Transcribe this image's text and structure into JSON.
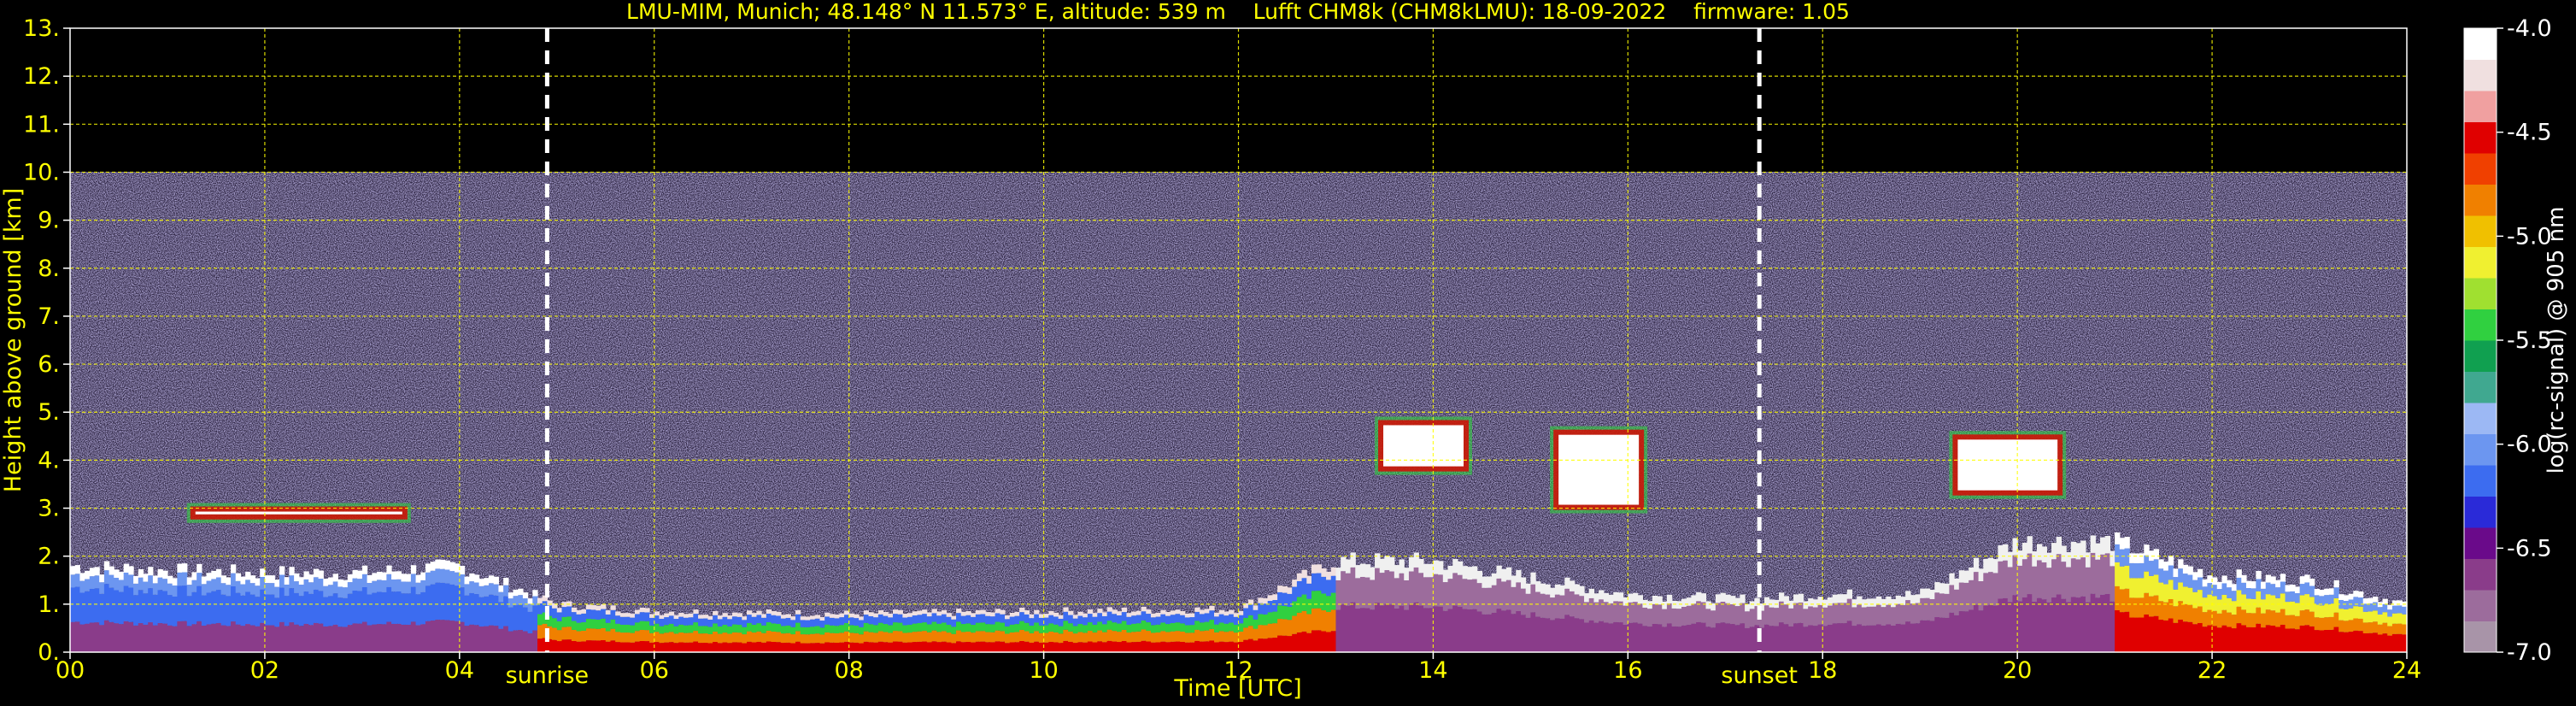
{
  "chart_data": {
    "type": "heatmap",
    "title": "LMU-MIM, Munich; 48.148° N 11.573° E, altitude: 539 m    Lufft CHM8k (CHM8kLMU): 18-09-2022    firmware: 1.05",
    "xlabel": "Time [UTC]",
    "ylabel": "Height above ground [km]",
    "xlim": [
      0,
      24
    ],
    "ylim": [
      0,
      13
    ],
    "x_ticks": [
      "00",
      "02",
      "04",
      "06",
      "08",
      "10",
      "12",
      "14",
      "16",
      "18",
      "20",
      "22",
      "24"
    ],
    "y_ticks": [
      "0.",
      "1.",
      "2.",
      "3.",
      "4.",
      "5.",
      "6.",
      "7.",
      "8.",
      "9.",
      "10.",
      "11.",
      "12.",
      "13."
    ],
    "grid": true,
    "measurement_top_km": 10,
    "annotations": [
      {
        "label": "sunrise",
        "time_h": 4.9
      },
      {
        "label": "sunset",
        "time_h": 17.35
      }
    ],
    "colorbar": {
      "label": "log(rc-signal) @ 905 nm",
      "range": [
        -7.0,
        -4.0
      ],
      "ticks": [
        "-4.0",
        "-4.5",
        "-5.0",
        "-5.5",
        "-6.0",
        "-6.5",
        "-7.0"
      ],
      "colors": [
        "#a894a8",
        "#9c6c9c",
        "#8a3c8a",
        "#6a0a8a",
        "#2a2ad8",
        "#3c6cf0",
        "#6c96f0",
        "#9cb8f4",
        "#40a890",
        "#10a050",
        "#30d040",
        "#a0e030",
        "#f0f030",
        "#f0c000",
        "#f08000",
        "#f04000",
        "#e00000",
        "#f0a0a0",
        "#f0e0e0",
        "#ffffff"
      ]
    },
    "features": {
      "boundary_layer": [
        [
          0,
          1.8
        ],
        [
          1,
          1.7
        ],
        [
          2,
          1.65
        ],
        [
          3,
          1.65
        ],
        [
          4,
          1.8
        ],
        [
          5,
          1.0
        ],
        [
          6,
          0.85
        ],
        [
          8,
          0.8
        ],
        [
          10,
          0.85
        ],
        [
          12,
          0.9
        ],
        [
          13,
          1.9
        ],
        [
          14,
          1.9
        ],
        [
          16,
          1.2
        ],
        [
          17.3,
          1.1
        ],
        [
          18,
          1.2
        ],
        [
          19,
          1.2
        ],
        [
          20,
          2.3
        ],
        [
          21,
          2.3
        ],
        [
          22,
          1.6
        ],
        [
          23,
          1.5
        ],
        [
          24,
          1.0
        ]
      ],
      "cloud_layers": [
        {
          "t_start": 1.2,
          "t_end": 3.5,
          "base_km": 2.8,
          "top_km": 3.0
        },
        {
          "t_start": 13.4,
          "t_end": 14.4,
          "base_km": 3.8,
          "top_km": 4.8
        },
        {
          "t_start": 15.2,
          "t_end": 16.2,
          "base_km": 3.0,
          "top_km": 4.6
        },
        {
          "t_start": 19.3,
          "t_end": 20.5,
          "base_km": 3.3,
          "top_km": 4.5
        }
      ]
    }
  }
}
